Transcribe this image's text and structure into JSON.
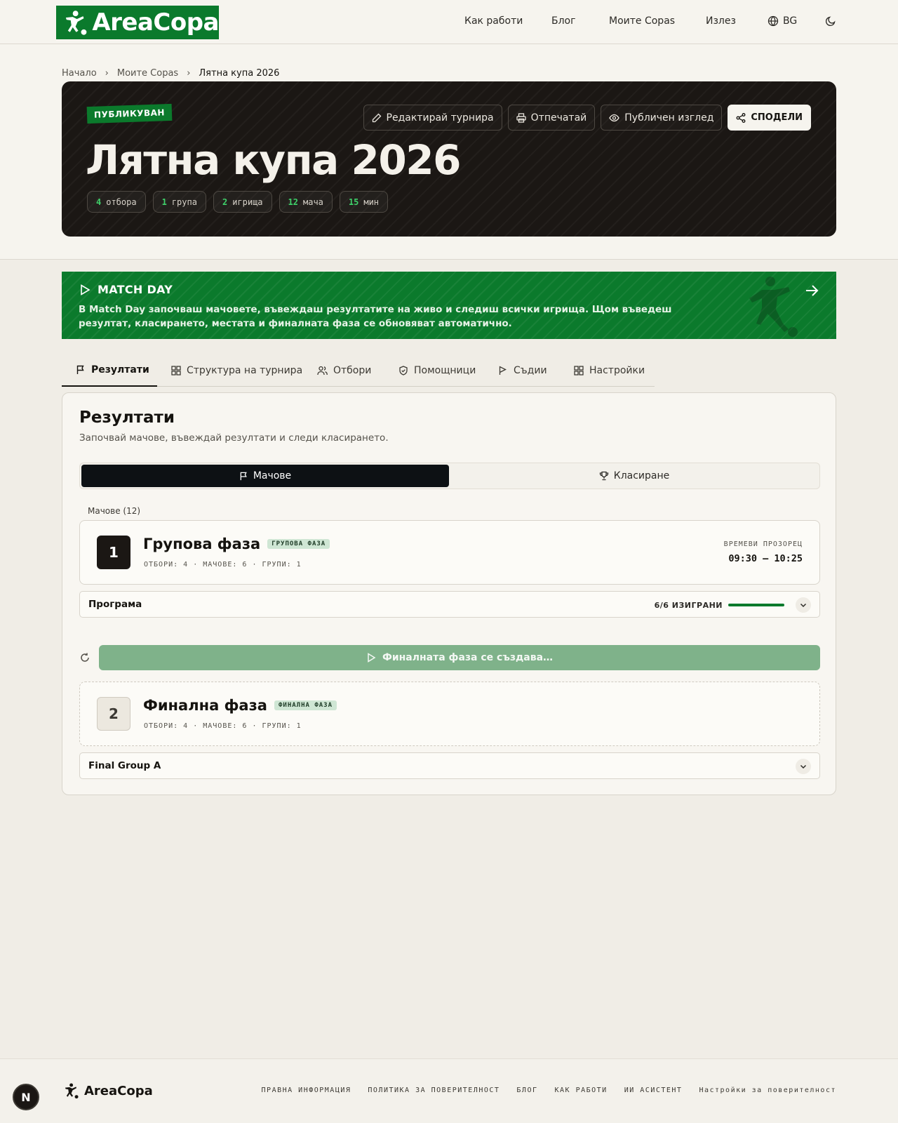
{
  "brand": {
    "name": "AreaCopa",
    "color": "#0b7a2c"
  },
  "nav": {
    "how_it_works": "Как работи",
    "blog": "Блог",
    "my_copas": "Моите Copas",
    "logout": "Излез",
    "language": "BG"
  },
  "breadcrumb": {
    "home": "Начало",
    "my_copas": "Моите Copas",
    "current": "Лятна купа 2026"
  },
  "hero": {
    "status": "ПУБЛИКУВАН",
    "title": "Лятна купа 2026",
    "actions": {
      "edit": "Редактирай турнира",
      "print": "Отпечатай",
      "public_view": "Публичен изглед",
      "share": "СПОДЕЛИ"
    },
    "stats": [
      {
        "value": "4",
        "label": "отбора"
      },
      {
        "value": "1",
        "label": "група"
      },
      {
        "value": "2",
        "label": "игрища"
      },
      {
        "value": "12",
        "label": "мача"
      },
      {
        "value": "15",
        "label": "мин"
      }
    ]
  },
  "match_day": {
    "title": "MATCH DAY",
    "text": "В Match Day започваш мачовете, въвеждаш резултатите на живо и следиш всички игрища. Щом въведеш резултат, класирането, местата и финалната фаза се обновяват автоматично."
  },
  "tabs": [
    "Резултати",
    "Структура на турнира",
    "Отбори",
    "Помощници",
    "Съдии",
    "Настройки"
  ],
  "results": {
    "title": "Резултати",
    "subtitle": "Започвай мачове, въвеждай резултати и следи класирането.",
    "segments": {
      "matches": "Мачове",
      "standings": "Класиране"
    },
    "matches_count": "Мачове (12)",
    "phase1": {
      "number": "1",
      "name": "Групова фаза",
      "tag": "ГРУПОВА ФАЗА",
      "meta": "ОТБОРИ: 4 · МАЧОВЕ: 6 · ГРУПИ: 1",
      "window_label": "ВРЕМЕВИ ПРОЗОРЕЦ",
      "window_value": "09:30 – 10:25"
    },
    "schedule": {
      "title": "Програма",
      "played": "6/6 ИЗИГРАНИ",
      "progress": 1.0
    },
    "final_button": "Финалната фаза се създава…",
    "phase2": {
      "number": "2",
      "name": "Финална фаза",
      "tag": "ФИНАЛНА ФАЗА",
      "meta": "ОТБОРИ: 4 · МАЧОВЕ: 6 · ГРУПИ: 1"
    },
    "final_group": {
      "title": "Final Group A"
    }
  },
  "footer": {
    "links": [
      "ПРАВНА ИНФОРМАЦИЯ",
      "ПОЛИТИКА ЗА ПОВЕРИТЕЛНОСТ",
      "БЛОГ",
      "КАК РАБОТИ",
      "ИИ АСИСТЕНТ",
      "Настройки за поверителност"
    ],
    "badge": "N"
  }
}
